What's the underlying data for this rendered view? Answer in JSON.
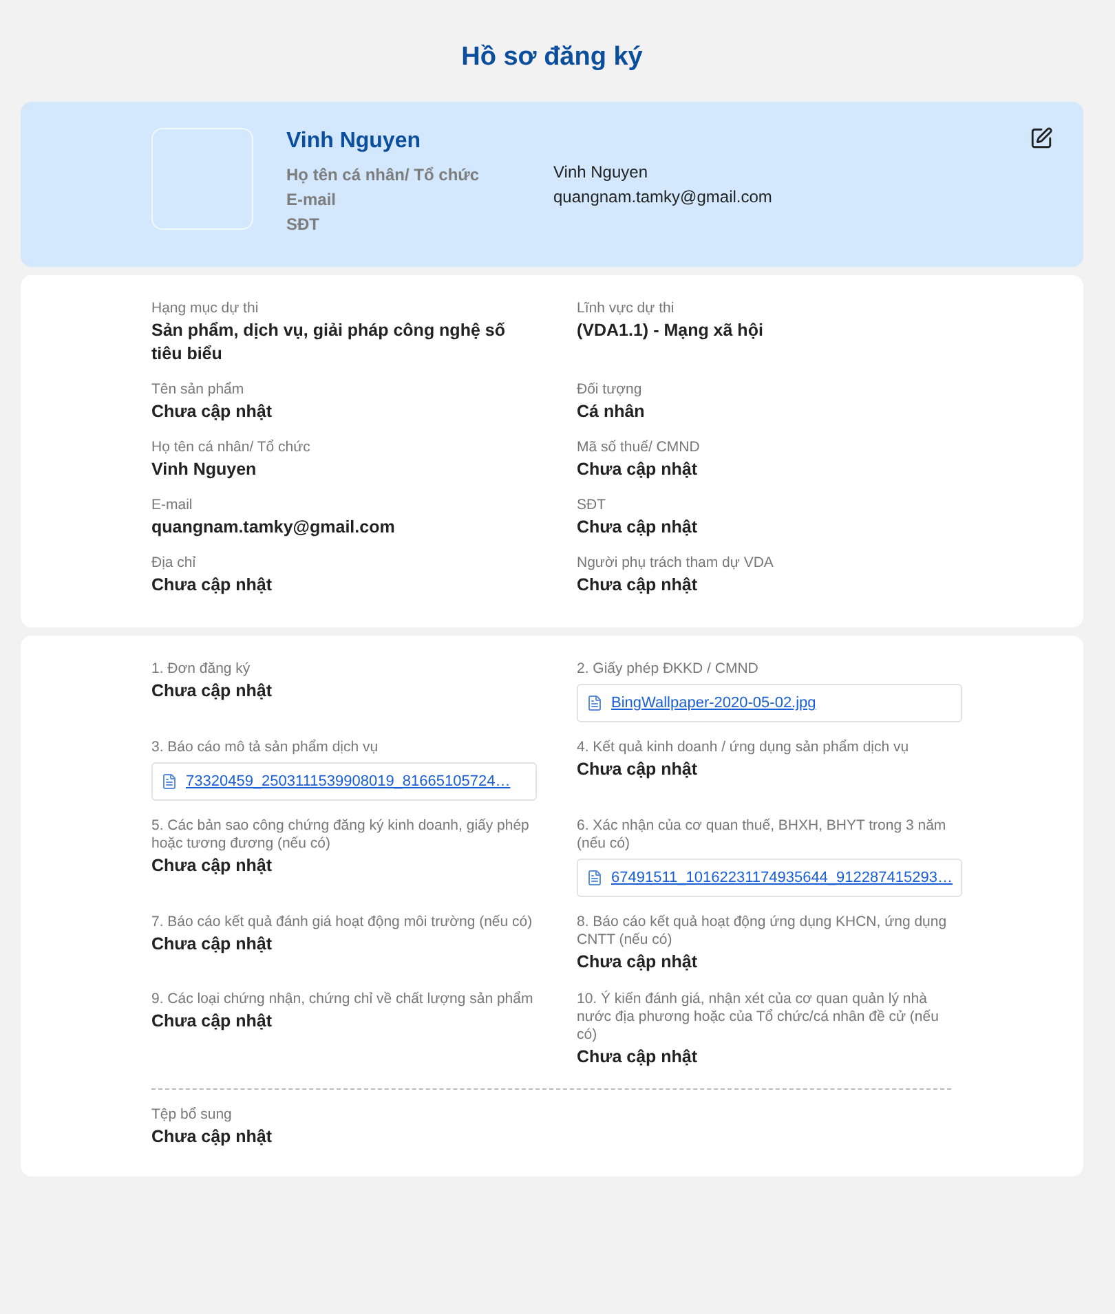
{
  "title": "Hồ sơ đăng ký",
  "profile": {
    "name": "Vinh Nguyen",
    "fields": [
      {
        "label": "Họ tên cá nhân/ Tổ chức",
        "value": "Vinh Nguyen"
      },
      {
        "label": "E-mail",
        "value": "quangnam.tamky@gmail.com"
      },
      {
        "label": "SĐT"
      }
    ]
  },
  "details": [
    {
      "label": "Hạng mục dự thi",
      "value": "Sản phẩm, dịch vụ, giải pháp công nghệ số tiêu biểu"
    },
    {
      "label": "Lĩnh vực dự thi",
      "value": "(VDA1.1) - Mạng xã hội"
    },
    {
      "label": "Tên sản phẩm",
      "value": "Chưa cập nhật"
    },
    {
      "label": "Đối tượng",
      "value": "Cá nhân"
    },
    {
      "label": "Họ tên cá nhân/ Tổ chức",
      "value": "Vinh Nguyen"
    },
    {
      "label": "Mã số thuế/ CMND",
      "value": "Chưa cập nhật"
    },
    {
      "label": "E-mail",
      "value": "quangnam.tamky@gmail.com"
    },
    {
      "label": "SĐT",
      "value": "Chưa cập nhật"
    },
    {
      "label": "Địa chỉ",
      "value": "Chưa cập nhật"
    },
    {
      "label": "Người phụ trách tham dự VDA",
      "value": "Chưa cập nhật"
    }
  ],
  "documents": [
    {
      "label": "1. Đơn đăng ký",
      "kind": "text",
      "value": "Chưa cập nhật"
    },
    {
      "label": "2. Giấy phép ĐKKD / CMND",
      "kind": "file",
      "value": "BingWallpaper-2020-05-02.jpg"
    },
    {
      "label": "3. Báo cáo mô tả sản phẩm dịch vụ",
      "kind": "file",
      "value": "73320459_2503111539908019_81665105724…"
    },
    {
      "label": "4. Kết quả kinh doanh / ứng dụng sản phẩm dịch vụ",
      "kind": "text",
      "value": "Chưa cập nhật"
    },
    {
      "label": "5. Các bản sao công chứng đăng ký kinh doanh, giấy phép hoặc tương đương (nếu có)",
      "kind": "text",
      "value": "Chưa cập nhật"
    },
    {
      "label": "6. Xác nhận của cơ quan thuế, BHXH, BHYT trong 3 năm (nếu có)",
      "kind": "file",
      "value": "67491511_10162231174935644_912287415293…"
    },
    {
      "label": "7. Báo cáo kết quả đánh giá hoạt động môi trường (nếu có)",
      "kind": "text",
      "value": "Chưa cập nhật"
    },
    {
      "label": "8. Báo cáo kết quả hoạt động ứng dụng KHCN, ứng dụng CNTT (nếu có)",
      "kind": "text",
      "value": "Chưa cập nhật"
    },
    {
      "label": "9. Các loại chứng nhận, chứng chỉ về chất lượng sản phẩm",
      "kind": "text",
      "value": "Chưa cập nhật"
    },
    {
      "label": "10. Ý kiến đánh giá, nhận xét của cơ quan quản lý nhà nước địa phương hoặc của Tổ chức/cá nhân đề cử (nếu có)",
      "kind": "text",
      "value": "Chưa cập nhật"
    }
  ],
  "extra": {
    "label": "Tệp bổ sung",
    "value": "Chưa cập nhật"
  }
}
